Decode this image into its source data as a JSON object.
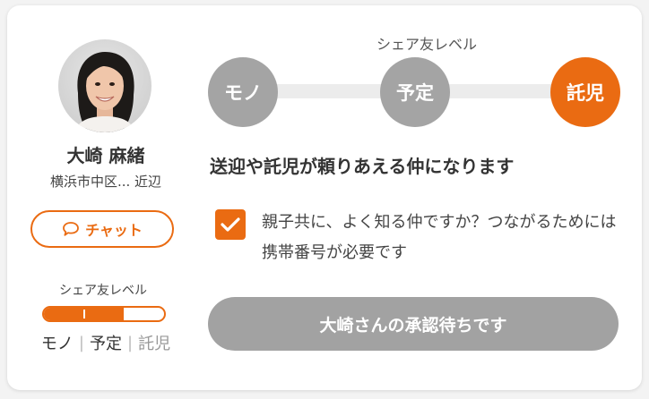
{
  "profile": {
    "name": "大崎 麻緒",
    "location": "横浜市中区... 近辺",
    "avatar_icon": "user-photo"
  },
  "chat_button": {
    "label": "チャット",
    "icon": "speech-bubble-icon"
  },
  "mini_level": {
    "title": "シェア友レベル",
    "labels": [
      "モノ",
      "予定",
      "託児"
    ],
    "divider": "|",
    "progress_fraction": 0.667
  },
  "share_level": {
    "title": "シェア友レベル",
    "steps": [
      {
        "label": "モノ",
        "state": "inactive"
      },
      {
        "label": "予定",
        "state": "inactive"
      },
      {
        "label": "託児",
        "state": "active"
      }
    ]
  },
  "message": "送迎や託児が頼りあえる仲になります",
  "consent": {
    "checked": true,
    "text": "親子共に、よく知る仲ですか？つながるためには携帯番号が必要です"
  },
  "pending_button": {
    "label": "大崎さんの承認待ちです"
  },
  "colors": {
    "accent": "#ea6b12",
    "inactive": "#a4a4a4",
    "track": "#ececec",
    "button_disabled": "#a2a2a2"
  }
}
